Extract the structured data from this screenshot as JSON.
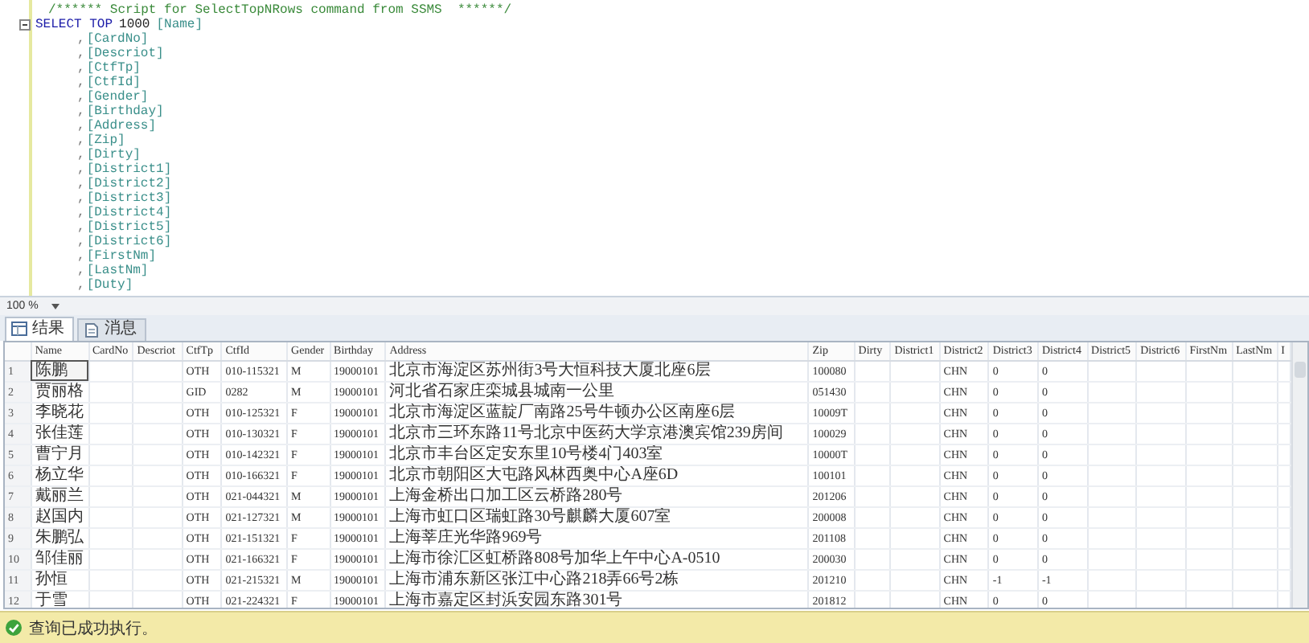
{
  "editor": {
    "lines": [
      {
        "kind": "comment",
        "tokens": [
          {
            "kind": "comment",
            "text": "/****** Script for SelectTopNRows command from SSMS  ******/"
          }
        ]
      },
      {
        "kind": "statement",
        "tokens": [
          {
            "kind": "keyword",
            "text": "SELECT TOP"
          },
          {
            "kind": "number",
            "text": "1000"
          },
          {
            "kind": "identifier",
            "text": "[Name]"
          }
        ]
      },
      {
        "kind": "continuation",
        "tokens": [
          {
            "kind": "punct",
            "text": ","
          },
          {
            "kind": "identifier",
            "text": "[CardNo]"
          }
        ]
      },
      {
        "kind": "continuation",
        "tokens": [
          {
            "kind": "punct",
            "text": ","
          },
          {
            "kind": "identifier",
            "text": "[Descriot]"
          }
        ]
      },
      {
        "kind": "continuation",
        "tokens": [
          {
            "kind": "punct",
            "text": ","
          },
          {
            "kind": "identifier",
            "text": "[CtfTp]"
          }
        ]
      },
      {
        "kind": "continuation",
        "tokens": [
          {
            "kind": "punct",
            "text": ","
          },
          {
            "kind": "identifier",
            "text": "[CtfId]"
          }
        ]
      },
      {
        "kind": "continuation",
        "tokens": [
          {
            "kind": "punct",
            "text": ","
          },
          {
            "kind": "identifier",
            "text": "[Gender]"
          }
        ]
      },
      {
        "kind": "continuation",
        "tokens": [
          {
            "kind": "punct",
            "text": ","
          },
          {
            "kind": "identifier",
            "text": "[Birthday]"
          }
        ]
      },
      {
        "kind": "continuation",
        "tokens": [
          {
            "kind": "punct",
            "text": ","
          },
          {
            "kind": "identifier",
            "text": "[Address]"
          }
        ]
      },
      {
        "kind": "continuation",
        "tokens": [
          {
            "kind": "punct",
            "text": ","
          },
          {
            "kind": "identifier",
            "text": "[Zip]"
          }
        ]
      },
      {
        "kind": "continuation",
        "tokens": [
          {
            "kind": "punct",
            "text": ","
          },
          {
            "kind": "identifier",
            "text": "[Dirty]"
          }
        ]
      },
      {
        "kind": "continuation",
        "tokens": [
          {
            "kind": "punct",
            "text": ","
          },
          {
            "kind": "identifier",
            "text": "[District1]"
          }
        ]
      },
      {
        "kind": "continuation",
        "tokens": [
          {
            "kind": "punct",
            "text": ","
          },
          {
            "kind": "identifier",
            "text": "[District2]"
          }
        ]
      },
      {
        "kind": "continuation",
        "tokens": [
          {
            "kind": "punct",
            "text": ","
          },
          {
            "kind": "identifier",
            "text": "[District3]"
          }
        ]
      },
      {
        "kind": "continuation",
        "tokens": [
          {
            "kind": "punct",
            "text": ","
          },
          {
            "kind": "identifier",
            "text": "[District4]"
          }
        ]
      },
      {
        "kind": "continuation",
        "tokens": [
          {
            "kind": "punct",
            "text": ","
          },
          {
            "kind": "identifier",
            "text": "[District5]"
          }
        ]
      },
      {
        "kind": "continuation",
        "tokens": [
          {
            "kind": "punct",
            "text": ","
          },
          {
            "kind": "identifier",
            "text": "[District6]"
          }
        ]
      },
      {
        "kind": "continuation",
        "tokens": [
          {
            "kind": "punct",
            "text": ","
          },
          {
            "kind": "identifier",
            "text": "[FirstNm]"
          }
        ]
      },
      {
        "kind": "continuation",
        "tokens": [
          {
            "kind": "punct",
            "text": ","
          },
          {
            "kind": "identifier",
            "text": "[LastNm]"
          }
        ]
      },
      {
        "kind": "continuation",
        "tokens": [
          {
            "kind": "punct",
            "text": ","
          },
          {
            "kind": "identifier",
            "text": "[Duty]"
          }
        ]
      }
    ]
  },
  "zoom": {
    "value": "100 %"
  },
  "tabs": [
    {
      "label": "结果",
      "kind": "grid",
      "selected": true
    },
    {
      "label": "消息",
      "kind": "messages",
      "selected": false
    }
  ],
  "grid": {
    "columns": [
      "Name",
      "CardNo",
      "Descriot",
      "CtfTp",
      "CtfId",
      "Gender",
      "Birthday",
      "Address",
      "Zip",
      "Dirty",
      "District1",
      "District2",
      "District3",
      "District4",
      "District5",
      "District6",
      "FirstNm",
      "LastNm",
      "I"
    ],
    "rows": [
      {
        "number": "1",
        "selected": true,
        "name": "陈鹏",
        "ctf_tp": "OTH",
        "ctf_id": "010-115321",
        "gender": "M",
        "birthday": "19000101",
        "address": "北京市海淀区苏州街3号大恒科技大厦北座6层",
        "zip": "100080",
        "district2": "CHN",
        "district3": "0",
        "district4": "0"
      },
      {
        "number": "2",
        "selected": false,
        "name": "贾丽格",
        "ctf_tp": "GID",
        "ctf_id": "0282",
        "gender": "M",
        "birthday": "19000101",
        "address": "河北省石家庄栾城县城南一公里",
        "zip": "051430",
        "district2": "CHN",
        "district3": "0",
        "district4": "0"
      },
      {
        "number": "3",
        "selected": false,
        "name": "李晓花",
        "ctf_tp": "OTH",
        "ctf_id": "010-125321",
        "gender": "F",
        "birthday": "19000101",
        "address": "北京市海淀区蓝靛厂南路25号牛顿办公区南座6层",
        "zip": "10009T",
        "district2": "CHN",
        "district3": "0",
        "district4": "0"
      },
      {
        "number": "4",
        "selected": false,
        "name": "张佳莲",
        "ctf_tp": "OTH",
        "ctf_id": "010-130321",
        "gender": "F",
        "birthday": "19000101",
        "address": "北京市三环东路11号北京中医药大学京港澳宾馆239房间",
        "zip": "100029",
        "district2": "CHN",
        "district3": "0",
        "district4": "0"
      },
      {
        "number": "5",
        "selected": false,
        "name": "曹宁月",
        "ctf_tp": "OTH",
        "ctf_id": "010-142321",
        "gender": "F",
        "birthday": "19000101",
        "address": "北京市丰台区定安东里10号楼4门403室",
        "zip": "10000T",
        "district2": "CHN",
        "district3": "0",
        "district4": "0"
      },
      {
        "number": "6",
        "selected": false,
        "name": "杨立华",
        "ctf_tp": "OTH",
        "ctf_id": "010-166321",
        "gender": "F",
        "birthday": "19000101",
        "address": "北京市朝阳区大屯路风林西奥中心A座6D",
        "zip": "100101",
        "district2": "CHN",
        "district3": "0",
        "district4": "0"
      },
      {
        "number": "7",
        "selected": false,
        "name": "戴丽兰",
        "ctf_tp": "OTH",
        "ctf_id": "021-044321",
        "gender": "M",
        "birthday": "19000101",
        "address": "上海金桥出口加工区云桥路280号",
        "zip": "201206",
        "district2": "CHN",
        "district3": "0",
        "district4": "0"
      },
      {
        "number": "8",
        "selected": false,
        "name": "赵国内",
        "ctf_tp": "OTH",
        "ctf_id": "021-127321",
        "gender": "M",
        "birthday": "19000101",
        "address": "上海市虹口区瑞虹路30号麒麟大厦607室",
        "zip": "200008",
        "district2": "CHN",
        "district3": "0",
        "district4": "0"
      },
      {
        "number": "9",
        "selected": false,
        "name": "朱鹏弘",
        "ctf_tp": "OTH",
        "ctf_id": "021-151321",
        "gender": "F",
        "birthday": "19000101",
        "address": "上海莘庄光华路969号",
        "zip": "201108",
        "district2": "CHN",
        "district3": "0",
        "district4": "0"
      },
      {
        "number": "10",
        "selected": false,
        "name": "邹佳丽",
        "ctf_tp": "OTH",
        "ctf_id": "021-166321",
        "gender": "F",
        "birthday": "19000101",
        "address": "上海市徐汇区虹桥路808号加华上午中心A-0510",
        "zip": "200030",
        "district2": "CHN",
        "district3": "0",
        "district4": "0"
      },
      {
        "number": "11",
        "selected": false,
        "name": "孙恒",
        "ctf_tp": "OTH",
        "ctf_id": "021-215321",
        "gender": "M",
        "birthday": "19000101",
        "address": "上海市浦东新区张江中心路218弄66号2栋",
        "zip": "201210",
        "district2": "CHN",
        "district3": "-1",
        "district4": "-1"
      },
      {
        "number": "12",
        "selected": false,
        "name": "于雪",
        "ctf_tp": "OTH",
        "ctf_id": "021-224321",
        "gender": "F",
        "birthday": "19000101",
        "address": "上海市嘉定区封浜安园东路301号",
        "zip": "201812",
        "district2": "CHN",
        "district3": "0",
        "district4": "0"
      }
    ]
  },
  "status": {
    "text": "查询已成功执行。",
    "kind": "success"
  }
}
